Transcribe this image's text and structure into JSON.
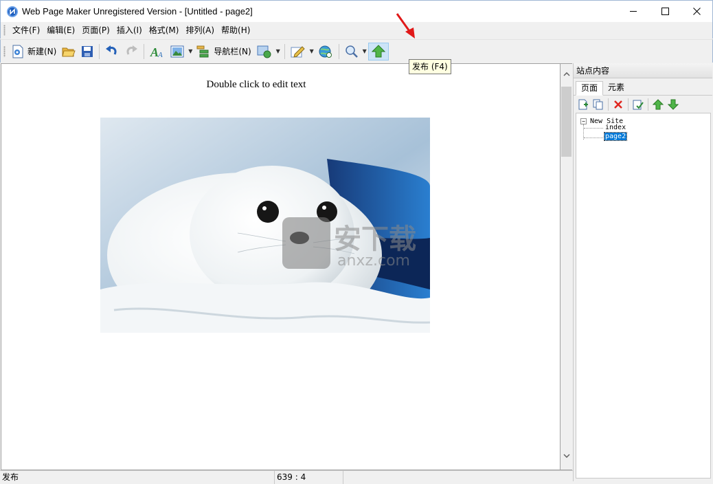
{
  "window": {
    "title": "Web Page Maker Unregistered Version - [Untitled - page2]"
  },
  "menu": [
    "文件(F)",
    "编辑(E)",
    "页面(P)",
    "插入(I)",
    "格式(M)",
    "排列(A)",
    "帮助(H)"
  ],
  "toolbar": {
    "new_label": "新建(N)",
    "navbar_label": "导航栏(N)",
    "publish_tooltip": "发布 (F4)"
  },
  "editor": {
    "placeholder_text": "Double click to edit text",
    "watermark_cn": "安下载",
    "watermark_url": "anxz.com"
  },
  "panel": {
    "title": "站点内容",
    "tabs": [
      "页面",
      "元素"
    ],
    "tree": {
      "root": "New Site",
      "children": [
        "index",
        "page2"
      ],
      "selected": "page2"
    }
  },
  "status": {
    "message": "发布",
    "position": "639 : 4"
  },
  "colors": {
    "publish_highlight": "#cce4f7",
    "selection": "#0078d7",
    "tooltip_bg": "#ffffe1"
  }
}
